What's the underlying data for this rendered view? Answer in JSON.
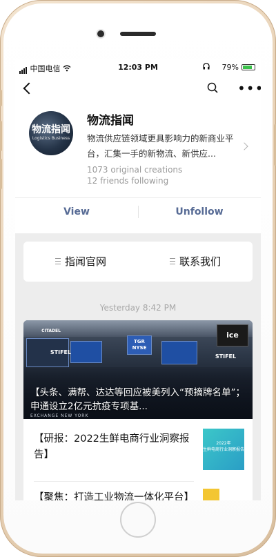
{
  "status_bar": {
    "carrier": "中国电信",
    "time": "12:03 PM",
    "battery_percent": "79%",
    "battery_level": 0.79,
    "battery_color": "#3ac24a"
  },
  "nav": {
    "back_icon": "chevron-left-icon",
    "search_icon": "search-icon",
    "more_icon": "more-horizontal-icon",
    "more_glyph": "•••"
  },
  "profile": {
    "avatar_logo_cn": "物流指闻",
    "avatar_logo_en": "Logistics Business",
    "name": "物流指闻",
    "description": "物流供应链领域更具影响力的新商业平台，汇集一手的新物流、新供应...",
    "original_creations": "1073 original creations",
    "friends_following": "12 friends following",
    "view_label": "View",
    "unfollow_label": "Unfollow",
    "link_color": "#576b95"
  },
  "menu": {
    "items": [
      {
        "label": "指闻官网"
      },
      {
        "label": "联系我们"
      }
    ]
  },
  "feed": {
    "timestamp": "Yesterday 8:42 PM",
    "hero": {
      "title": "【头条、满帮、达达等回应被美列入“预摘牌名单”；申通设立2亿元抗疫专项基...",
      "sign_left": "TGR",
      "sign_right": "NYSE",
      "sign_ice": "ice",
      "stifel_label": "STIFEL",
      "citadel_label": "CITADEL",
      "caption": "EXCHANGE   NEW YORK"
    },
    "sub_article": {
      "title": "【研报：2022生鲜电商行业洞察报告】",
      "thumb_year": "2022年",
      "thumb_text": "生鲜电商行业洞察报告"
    },
    "next_article": {
      "title": "【聚焦：打造工业物流一体化平台】"
    }
  }
}
